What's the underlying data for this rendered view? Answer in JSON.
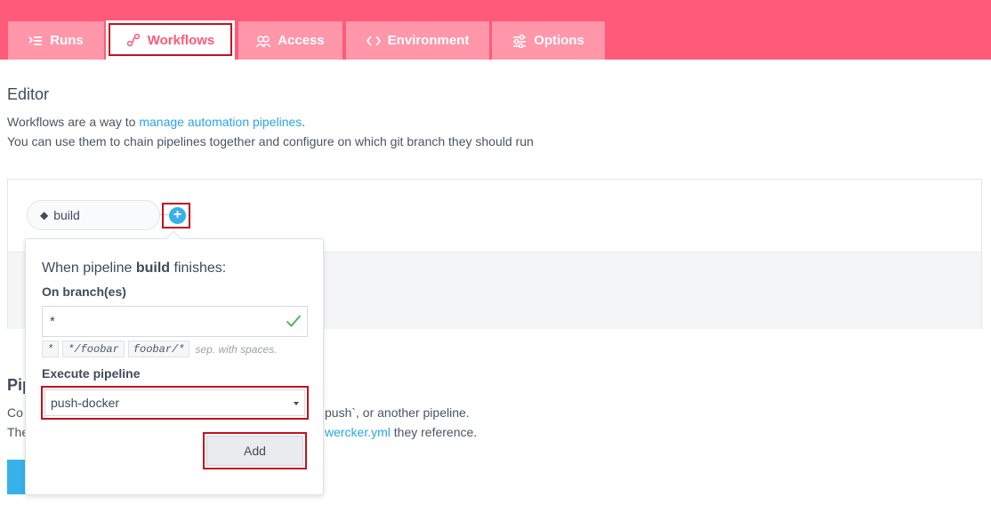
{
  "tabs": [
    {
      "label": "Runs",
      "icon": "list-icon"
    },
    {
      "label": "Workflows",
      "icon": "workflow-icon",
      "active": true
    },
    {
      "label": "Access",
      "icon": "users-icon"
    },
    {
      "label": "Environment",
      "icon": "code-icon"
    },
    {
      "label": "Options",
      "icon": "sliders-icon"
    }
  ],
  "editor": {
    "title": "Editor",
    "desc_line1_prefix": "Workflows are a way to ",
    "desc_line1_link": "manage automation pipelines",
    "desc_line1_suffix": ".",
    "desc_line2": "You can use them to chain pipelines together and configure on which git branch they should run"
  },
  "workflow": {
    "node_icon": "git-icon",
    "node_label": "build",
    "add_button_symbol": "+"
  },
  "popover": {
    "heading_prefix": "When pipeline",
    "heading_pipeline": "build",
    "heading_suffix": "finishes:",
    "branch_label": "On branch(es)",
    "branch_value": "*",
    "branch_hints": [
      "*",
      "*/foobar",
      "foobar/*"
    ],
    "branch_hint_text": "sep. with spaces.",
    "execute_label": "Execute pipeline",
    "selected_pipeline": "push-docker",
    "add_label": "Add"
  },
  "pipelines": {
    "title": "Pip",
    "line1_prefix": "Co",
    "line1_suffix": "push`, or another pipeline.",
    "line2_prefix": "The",
    "line2_link": "wercker.yml",
    "line2_suffix": "they reference."
  },
  "colors": {
    "topbar": "#ff5a79",
    "tab_inactive": "#ff96aa",
    "link": "#2aa5e6",
    "primary": "#36b1ea",
    "highlight_border": "#c4111e",
    "check": "#4caf50"
  }
}
